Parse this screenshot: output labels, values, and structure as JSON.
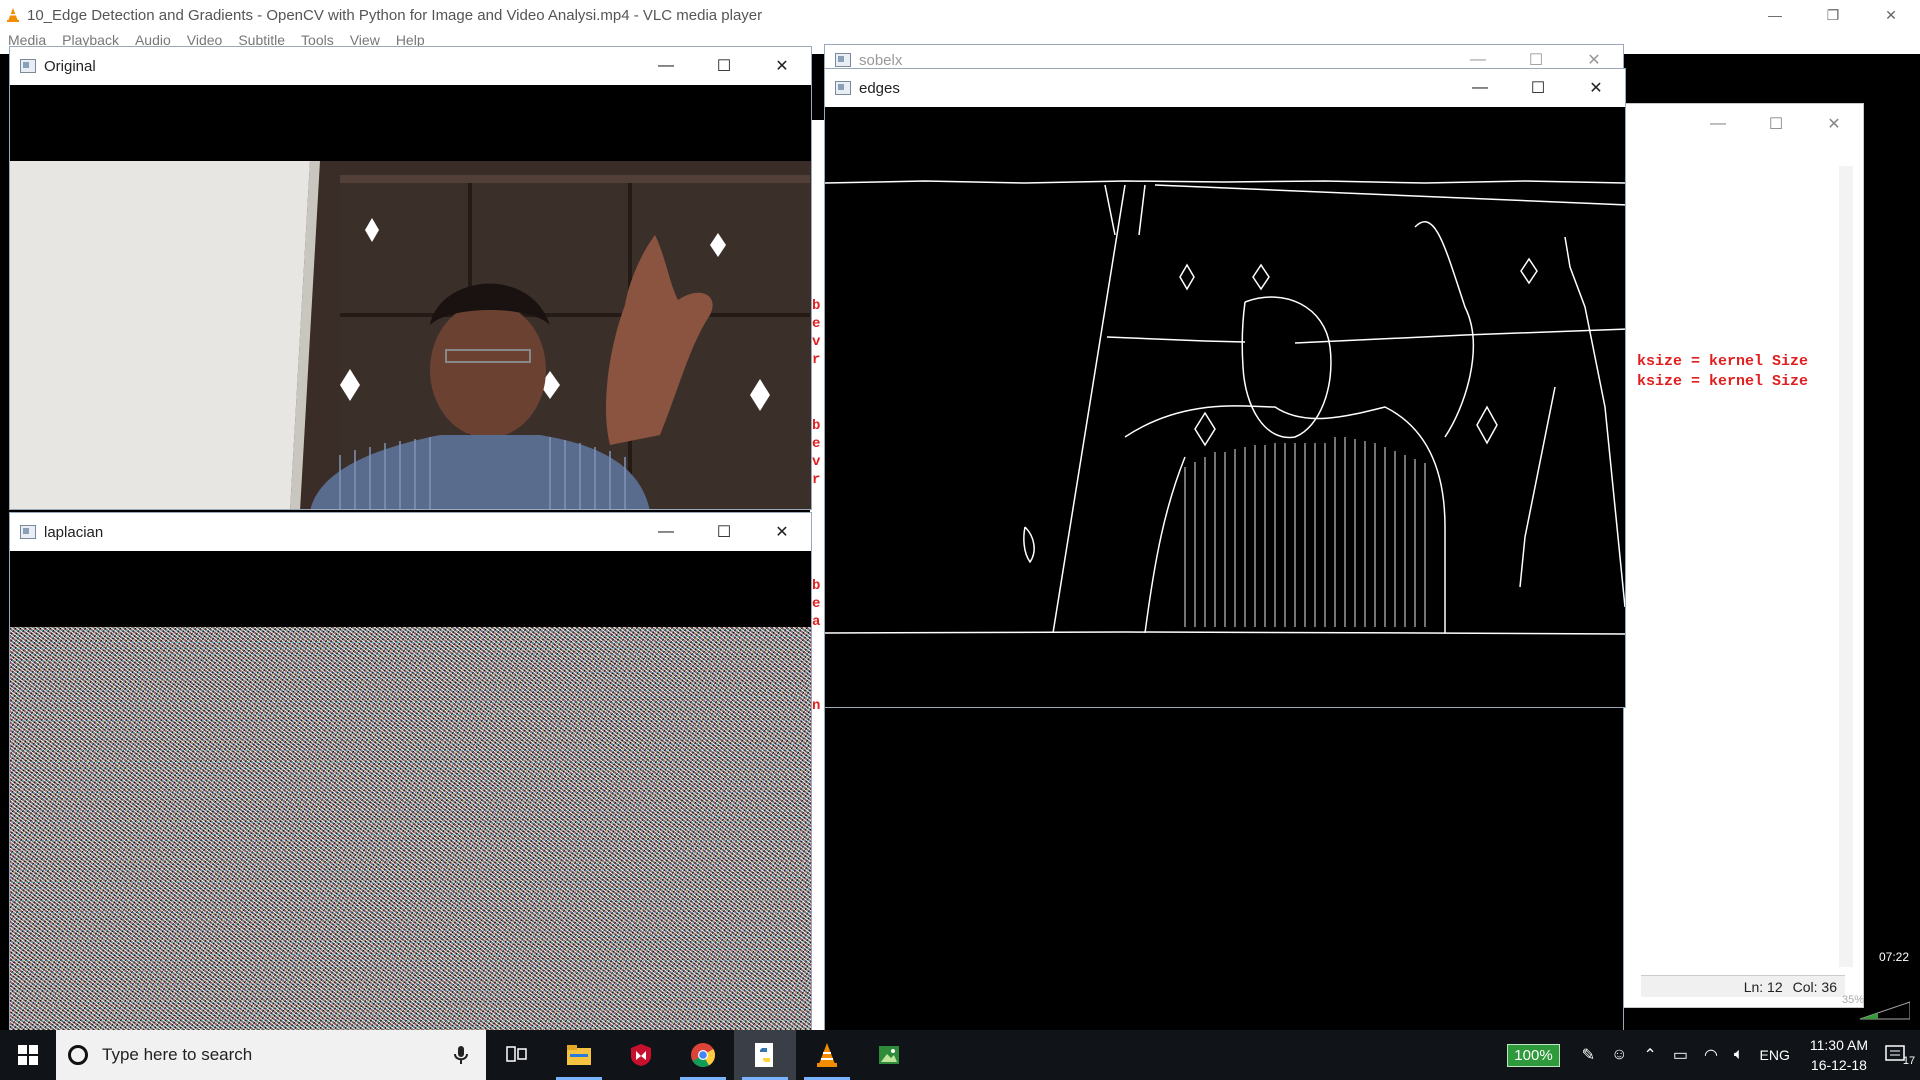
{
  "vlc": {
    "title": "10_Edge Detection and Gradients - OpenCV with Python for Image and Video Analysi.mp4 - VLC media player",
    "menu": [
      "Media",
      "Playback",
      "Audio",
      "Video",
      "Subtitle",
      "Tools",
      "View",
      "Help"
    ]
  },
  "windows": {
    "original": {
      "title": "Original"
    },
    "laplacian": {
      "title": "laplacian"
    },
    "sobelx": {
      "title": "sobelx"
    },
    "edges": {
      "title": "edges"
    }
  },
  "editor": {
    "code_lines": [
      "ksize = kernel Size",
      "ksize = kernel Size"
    ],
    "status_ln": "Ln: 12",
    "status_col": "Col: 36",
    "time_badge": "07:22",
    "volume": "35%"
  },
  "midstrip_letters": [
    "b",
    "e",
    "v",
    "r",
    "b",
    "e",
    "v",
    "r",
    "b",
    "e",
    "a",
    "n"
  ],
  "taskbar": {
    "search_placeholder": "Type here to search",
    "battery": "100%",
    "language": "ENG",
    "time": "11:30 AM",
    "date": "16-12-18",
    "notifications": "17",
    "apps": [
      "task-view",
      "file-explorer",
      "mcafee",
      "chrome",
      "python-idle",
      "vlc",
      "photos"
    ]
  }
}
